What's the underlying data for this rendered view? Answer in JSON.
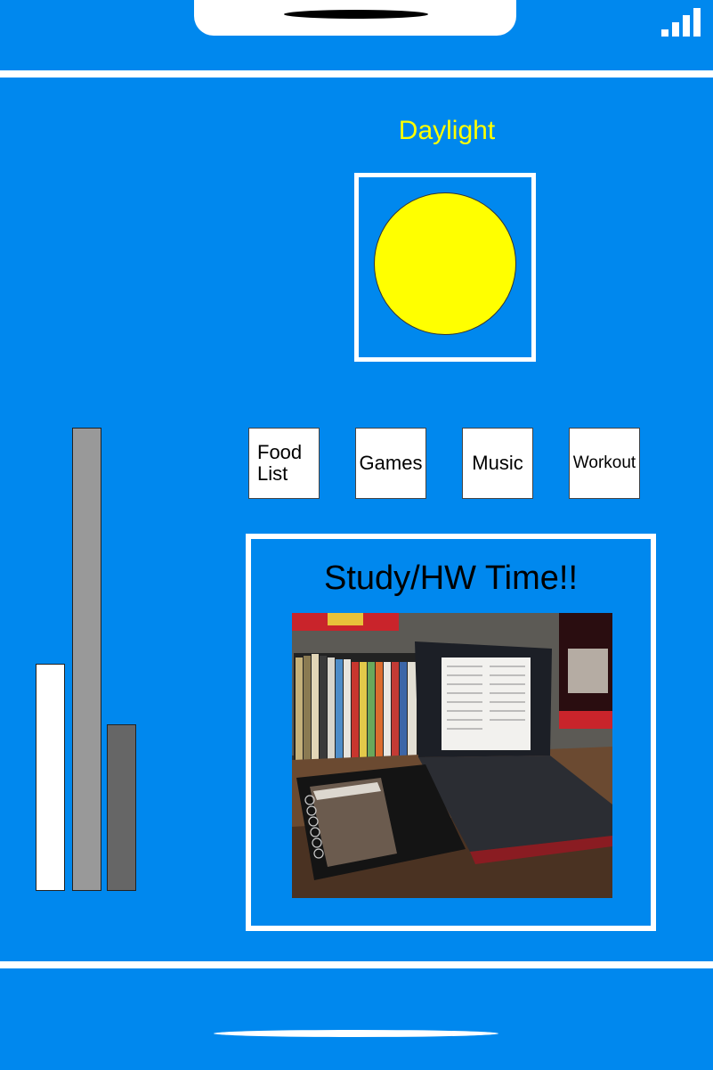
{
  "status_bar": {
    "signal_icon": "signal-strength-icon",
    "speaker_icon": "speaker-grille"
  },
  "daylight": {
    "label": "Daylight",
    "icon": "sun-icon",
    "sun_color": "#ffff00"
  },
  "bars": [
    {
      "name": "white-bar",
      "color": "#ffffff",
      "level": 0.49
    },
    {
      "name": "gray-bar",
      "color": "#999999",
      "level": 1.0
    },
    {
      "name": "dark-gray-bar",
      "color": "#666666",
      "level": 0.36
    }
  ],
  "apps": [
    {
      "label": "Food\nList",
      "name": "app-food-list"
    },
    {
      "label": "Games",
      "name": "app-games"
    },
    {
      "label": "Music",
      "name": "app-music"
    },
    {
      "label": "Workout",
      "name": "app-workout"
    }
  ],
  "study": {
    "title": "Study/HW Time!!"
  },
  "colors": {
    "background": "#0088ee",
    "accent": "#ffff00",
    "frame": "#ffffff"
  }
}
